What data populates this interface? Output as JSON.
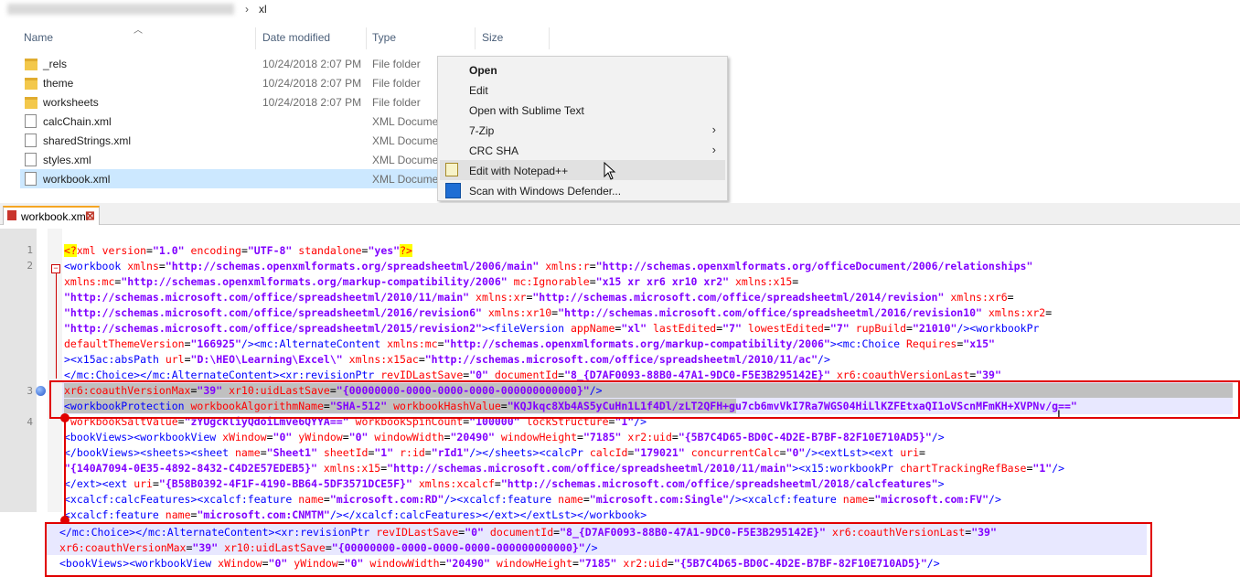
{
  "explorer": {
    "breadcrumb_current": "xl",
    "columns": {
      "name": "Name",
      "date": "Date modified",
      "type": "Type",
      "size": "Size"
    },
    "files": [
      {
        "name": "_rels",
        "date": "10/24/2018 2:07 PM",
        "type": "File folder",
        "icon": "folder-icon"
      },
      {
        "name": "theme",
        "date": "10/24/2018 2:07 PM",
        "type": "File folder",
        "icon": "folder-icon"
      },
      {
        "name": "worksheets",
        "date": "10/24/2018 2:07 PM",
        "type": "File folder",
        "icon": "folder-icon"
      },
      {
        "name": "calcChain.xml",
        "date": "",
        "type": "XML Docume",
        "icon": "xml-file-icon"
      },
      {
        "name": "sharedStrings.xml",
        "date": "",
        "type": "XML Docume",
        "icon": "xml-file-icon"
      },
      {
        "name": "styles.xml",
        "date": "",
        "type": "XML Docume",
        "icon": "xml-file-icon"
      },
      {
        "name": "workbook.xml",
        "date": "",
        "type": "XML Docume",
        "icon": "xml-file-icon",
        "selected": true
      }
    ]
  },
  "context_menu": {
    "items": [
      {
        "label": "Open",
        "bold": true
      },
      {
        "label": "Edit"
      },
      {
        "label": "Open with Sublime Text"
      },
      {
        "label": "7-Zip",
        "submenu": true
      },
      {
        "label": "CRC SHA",
        "submenu": true
      },
      {
        "label": "Edit with Notepad++",
        "icon": "notepad-plus-plus-icon",
        "highlighted": true
      },
      {
        "label": "Scan with Windows Defender...",
        "icon": "windows-defender-icon"
      }
    ]
  },
  "editor": {
    "tab_title": "workbook.xml",
    "line_numbers": [
      "1",
      "2",
      "3",
      "4"
    ],
    "colors": {
      "tag": "#0000ff",
      "attr": "#ff0000",
      "value": "#8000ff",
      "highlight_box": "#e10000"
    },
    "lines": [
      "<?xml version=\"1.0\" encoding=\"UTF-8\" standalone=\"yes\"?>",
      "<workbook xmlns=\"http://schemas.openxmlformats.org/spreadsheetml/2006/main\" xmlns:r=\"http://schemas.openxmlformats.org/officeDocument/2006/relationships\"",
      "xmlns:mc=\"http://schemas.openxmlformats.org/markup-compatibility/2006\" mc:Ignorable=\"x15 xr xr6 xr10 xr2\" xmlns:x15=",
      "\"http://schemas.microsoft.com/office/spreadsheetml/2010/11/main\" xmlns:xr=\"http://schemas.microsoft.com/office/spreadsheetml/2014/revision\" xmlns:xr6=",
      "\"http://schemas.microsoft.com/office/spreadsheetml/2016/revision6\" xmlns:xr10=\"http://schemas.microsoft.com/office/spreadsheetml/2016/revision10\" xmlns:xr2=",
      "\"http://schemas.microsoft.com/office/spreadsheetml/2015/revision2\"><fileVersion appName=\"xl\" lastEdited=\"7\" lowestEdited=\"7\" rupBuild=\"21010\"/><workbookPr",
      "defaultThemeVersion=\"166925\"/><mc:AlternateContent xmlns:mc=\"http://schemas.openxmlformats.org/markup-compatibility/2006\"><mc:Choice Requires=\"x15\"",
      "><x15ac:absPath url=\"D:\\HEO\\Learning\\Excel\\\" xmlns:x15ac=\"http://schemas.microsoft.com/office/spreadsheetml/2010/11/ac\"/>",
      "</mc:Choice></mc:AlternateContent><xr:revisionPtr revIDLastSave=\"0\" documentId=\"8_{D7AF0093-88B0-47A1-9DC0-F5E3B295142E}\" xr6:coauthVersionLast=\"39\"",
      "xr6:coauthVersionMax=\"39\" xr10:uidLastSave=\"{00000000-0000-0000-0000-000000000000}\"/>",
      "<workbookProtection workbookAlgorithmName=\"SHA-512\" workbookHashValue=\"KQJkqc8Xb4AS5yCuHn1L1f4Dl/zLT2QFH+gu7cb6mvVkI7Ra7WGS04HiLlKZFEtxaQI1oVScnMFmKH+XVPNv/g==\"",
      " workbookSaltValue=\"zYUgckliyQdoiLmve6QYYA==\" workbookSpinCount=\"100000\" lockStructure=\"1\"/>",
      "<bookViews><workbookView xWindow=\"0\" yWindow=\"0\" windowWidth=\"20490\" windowHeight=\"7185\" xr2:uid=\"{5B7C4D65-BD0C-4D2E-B7BF-82F10E710AD5}\"/>",
      "</bookViews><sheets><sheet name=\"Sheet1\" sheetId=\"1\" r:id=\"rId1\"/></sheets><calcPr calcId=\"179021\" concurrentCalc=\"0\"/><extLst><ext uri=",
      "\"{140A7094-0E35-4892-8432-C4D2E57EDEB5}\" xmlns:x15=\"http://schemas.microsoft.com/office/spreadsheetml/2010/11/main\"><x15:workbookPr chartTrackingRefBase=\"1\"/>",
      "</ext><ext uri=\"{B58B0392-4F1F-4190-BB64-5DF3571DCE5F}\" xmlns:xcalcf=\"http://schemas.microsoft.com/office/spreadsheetml/2018/calcfeatures\">",
      "<xcalcf:calcFeatures><xcalcf:feature name=\"microsoft.com:RD\"/><xcalcf:feature name=\"microsoft.com:Single\"/><xcalcf:feature name=\"microsoft.com:FV\"/>",
      "<xcalcf:feature name=\"microsoft.com:CNMTM\"/></xcalcf:calcFeatures></ext></extLst></workbook>"
    ]
  },
  "zoom": {
    "lines": [
      "</mc:Choice></mc:AlternateContent><xr:revisionPtr revIDLastSave=\"0\" documentId=\"8_{D7AF0093-88B0-47A1-9DC0-F5E3B295142E}\" xr6:coauthVersionLast=\"39\"",
      "xr6:coauthVersionMax=\"39\" xr10:uidLastSave=\"{00000000-0000-0000-0000-000000000000}\"/>",
      "<bookViews><workbookView xWindow=\"0\" yWindow=\"0\" windowWidth=\"20490\" windowHeight=\"7185\" xr2:uid=\"{5B7C4D65-BD0C-4D2E-B7BF-82F10E710AD5}\"/>"
    ]
  }
}
